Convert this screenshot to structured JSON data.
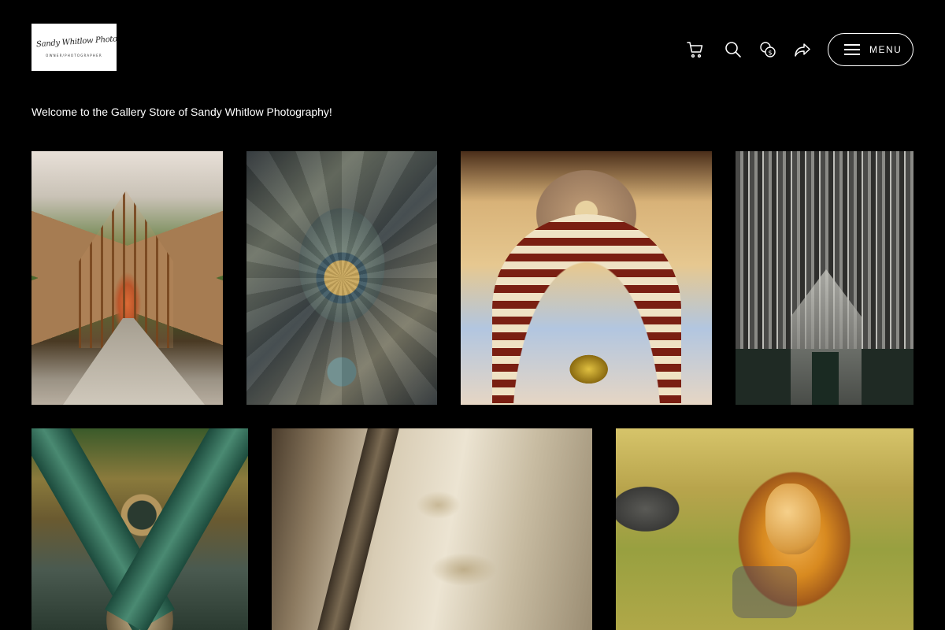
{
  "logo": {
    "script_text": "Sandy Whitlow Photography",
    "subtitle": "OWNER/PHOTOGRAPHER"
  },
  "header": {
    "icons": [
      "cart-icon",
      "search-icon",
      "currency-icon",
      "share-icon"
    ],
    "menu_label": "MENU"
  },
  "welcome_text": "Welcome to the Gallery Store of Sandy Whitlow Photography!",
  "gallery": [
    {
      "name": "glass-chapel-forest"
    },
    {
      "name": "mosaic-dome-ceiling"
    },
    {
      "name": "striped-arch-dome"
    },
    {
      "name": "gothic-cathedral-facade"
    },
    {
      "name": "green-column-ceiling"
    },
    {
      "name": "stone-arches"
    },
    {
      "name": "lion-portrait"
    }
  ]
}
